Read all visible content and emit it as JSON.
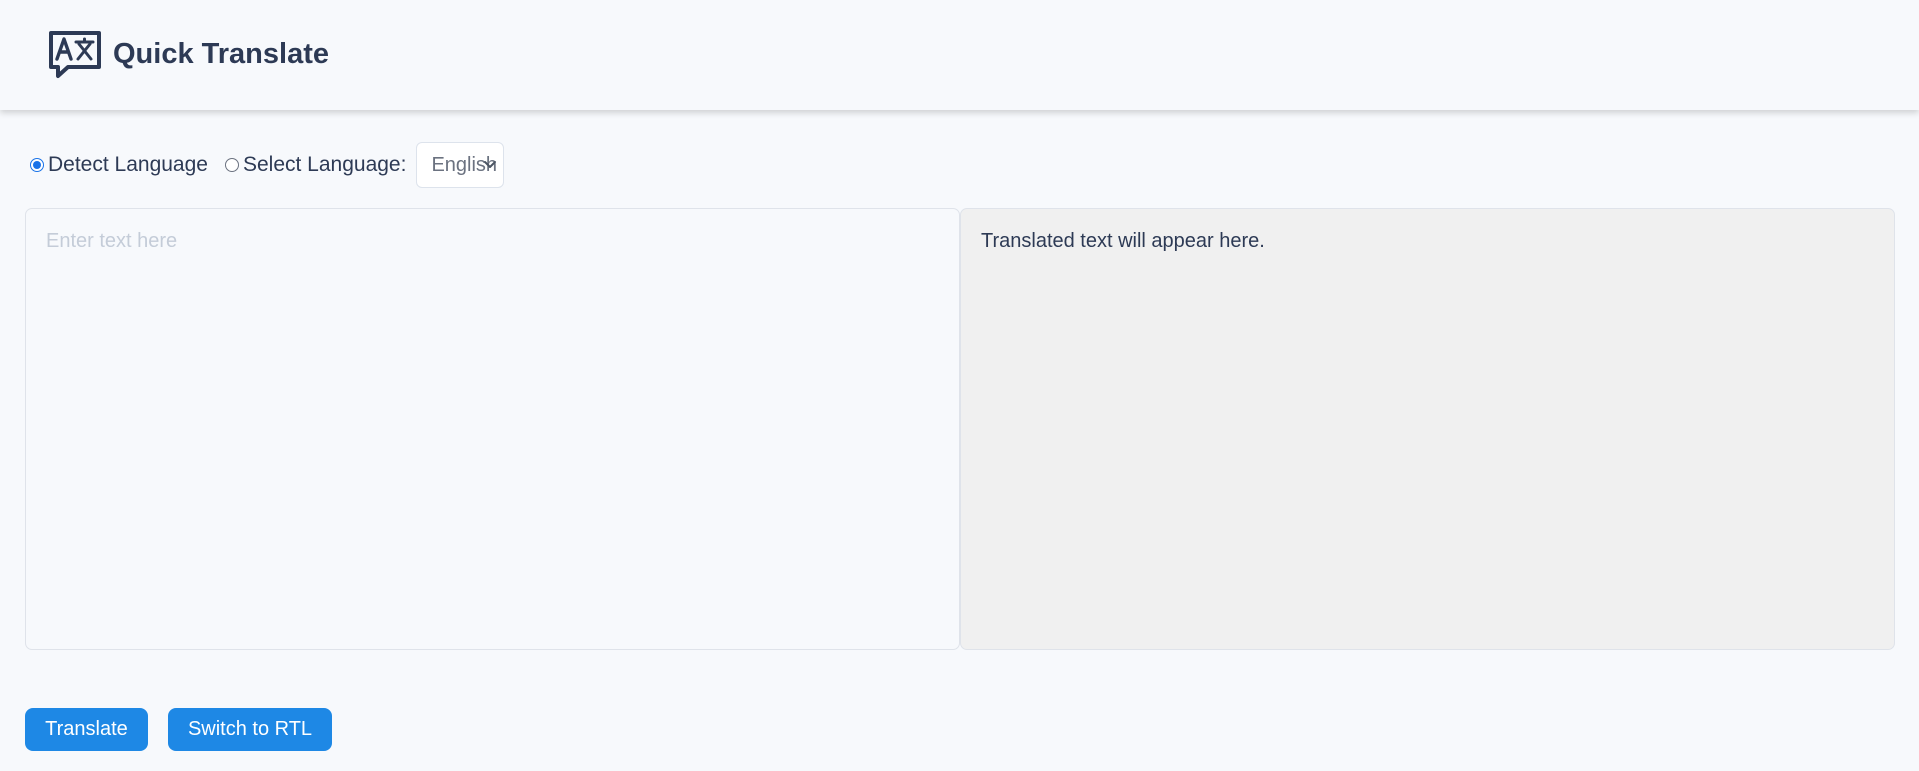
{
  "header": {
    "title": "Quick Translate",
    "logo_icon": "translate-icon"
  },
  "language": {
    "detect_label": "Detect Language",
    "detect_checked": true,
    "select_label": "Select Language:",
    "select_checked": false,
    "selected_language": "English"
  },
  "input": {
    "placeholder": "Enter text here",
    "value": ""
  },
  "output": {
    "text": "Translated text will appear here."
  },
  "buttons": {
    "translate_label": "Translate",
    "rtl_label": "Switch to RTL"
  },
  "colors": {
    "accent": "#1e88e5",
    "text": "#2d3a55",
    "background": "#f7f9fc",
    "output_background": "#f0f0f0"
  }
}
